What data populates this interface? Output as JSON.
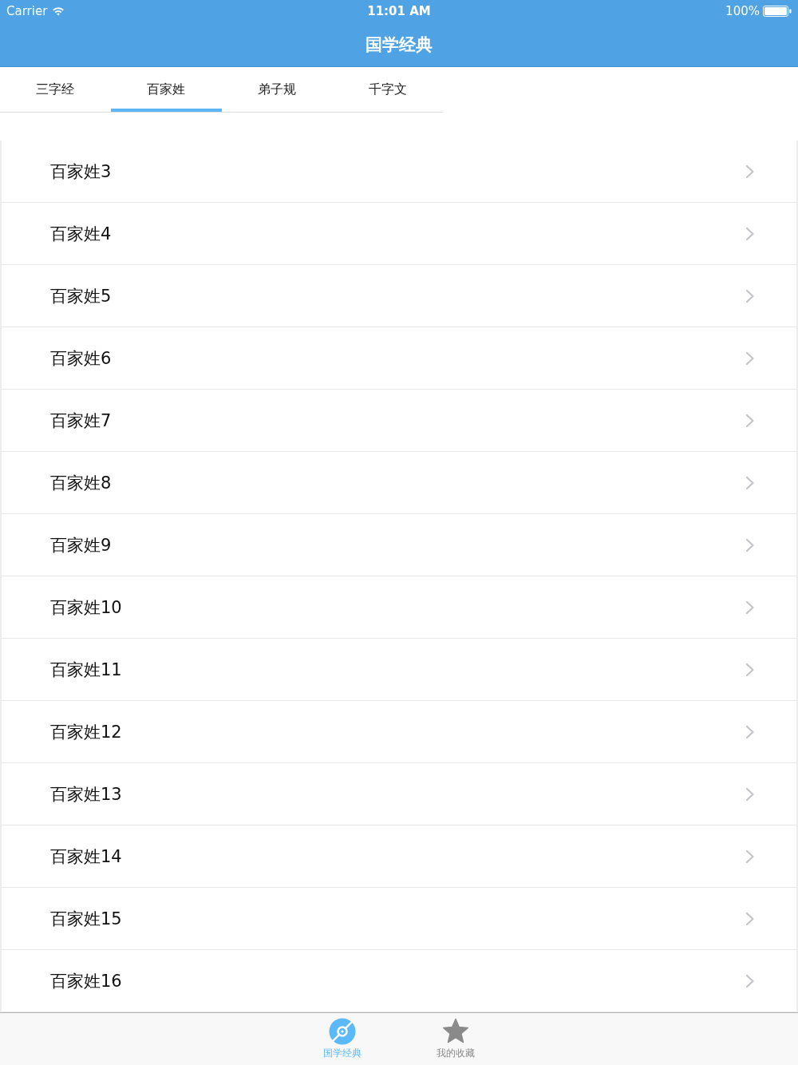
{
  "status_bar": {
    "carrier": "Carrier",
    "time": "11:01 AM",
    "battery": "100%"
  },
  "nav_bar": {
    "title": "国学经典"
  },
  "tabs": [
    {
      "label": "三字经",
      "selected": false
    },
    {
      "label": "百家姓",
      "selected": true
    },
    {
      "label": "弟子规",
      "selected": false
    },
    {
      "label": "千字文",
      "selected": false
    }
  ],
  "list": {
    "items": [
      {
        "title": "百家姓3"
      },
      {
        "title": "百家姓4"
      },
      {
        "title": "百家姓5"
      },
      {
        "title": "百家姓6"
      },
      {
        "title": "百家姓7"
      },
      {
        "title": "百家姓8"
      },
      {
        "title": "百家姓9"
      },
      {
        "title": "百家姓10"
      },
      {
        "title": "百家姓11"
      },
      {
        "title": "百家姓12"
      },
      {
        "title": "百家姓13"
      },
      {
        "title": "百家姓14"
      },
      {
        "title": "百家姓15"
      },
      {
        "title": "百家姓16"
      }
    ]
  },
  "tab_bar": {
    "items": [
      {
        "label": "国学经典",
        "selected": true
      },
      {
        "label": "我的收藏",
        "selected": false
      }
    ]
  }
}
